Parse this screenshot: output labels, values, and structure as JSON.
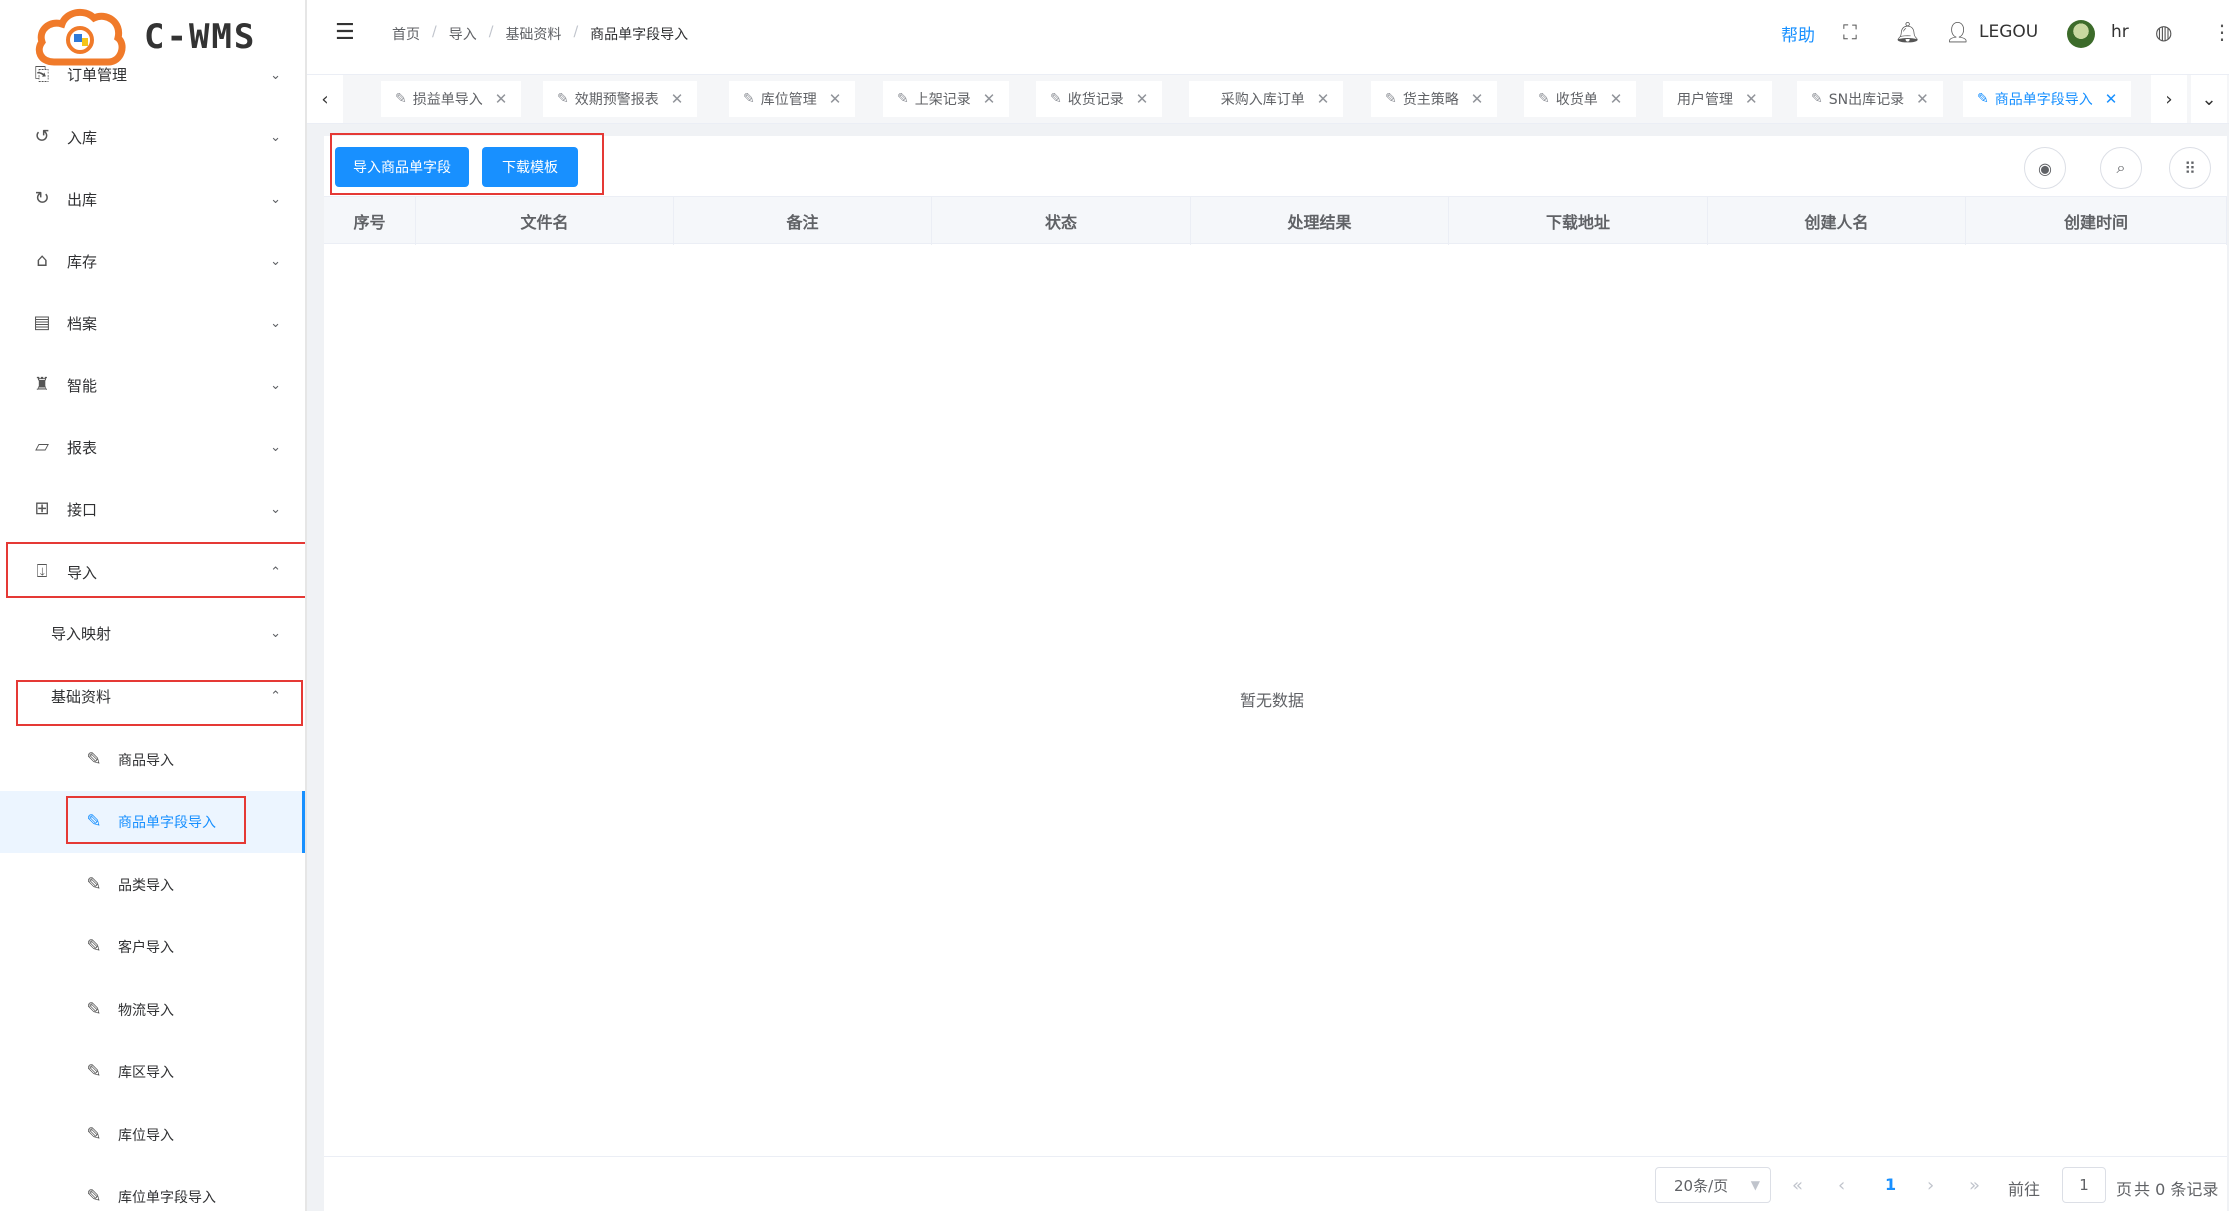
{
  "brand": {
    "logo_text": "C-WMS"
  },
  "sidebar": {
    "items": [
      {
        "label": "订单管理",
        "icon": "order-icon"
      },
      {
        "label": "入库",
        "icon": "inbound-icon"
      },
      {
        "label": "出库",
        "icon": "outbound-icon"
      },
      {
        "label": "库存",
        "icon": "inventory-icon"
      },
      {
        "label": "档案",
        "icon": "archive-icon"
      },
      {
        "label": "智能",
        "icon": "robot-icon"
      },
      {
        "label": "报表",
        "icon": "report-icon"
      },
      {
        "label": "接口",
        "icon": "api-icon"
      },
      {
        "label": "导入",
        "icon": "import-icon"
      }
    ],
    "sub_items": [
      {
        "label": "导入映射"
      },
      {
        "label": "基础资料"
      }
    ],
    "leaf_items": [
      {
        "label": "商品导入"
      },
      {
        "label": "商品单字段导入"
      },
      {
        "label": "品类导入"
      },
      {
        "label": "客户导入"
      },
      {
        "label": "物流导入"
      },
      {
        "label": "库区导入"
      },
      {
        "label": "库位导入"
      },
      {
        "label": "库位单字段导入"
      }
    ]
  },
  "header": {
    "breadcrumb": [
      "首页",
      "导入",
      "基础资料",
      "商品单字段导入"
    ],
    "help": "帮助",
    "user": "LEGOU",
    "role": "hr"
  },
  "tabs": [
    {
      "label": "损益单导入"
    },
    {
      "label": "效期预警报表"
    },
    {
      "label": "库位管理"
    },
    {
      "label": "上架记录"
    },
    {
      "label": "收货记录"
    },
    {
      "label": "采购入库订单"
    },
    {
      "label": "货主策略"
    },
    {
      "label": "收货单"
    },
    {
      "label": "用户管理"
    },
    {
      "label": "SN出库记录"
    },
    {
      "label": "商品单字段导入"
    }
  ],
  "toolbar": {
    "import_label": "导入商品单字段",
    "download_label": "下载模板"
  },
  "table": {
    "columns": [
      "序号",
      "文件名",
      "备注",
      "状态",
      "处理结果",
      "下载地址",
      "创建人名",
      "创建时间"
    ],
    "rows": [],
    "empty_text": "暂无数据"
  },
  "pagination": {
    "page_size": "20条/页",
    "current_page": "1",
    "goto_prefix": "前往",
    "goto_value": "1",
    "goto_suffix": "页",
    "total_text": "共 0 条记录"
  },
  "colors": {
    "primary": "#1890ff",
    "highlight_box": "#e53935"
  }
}
